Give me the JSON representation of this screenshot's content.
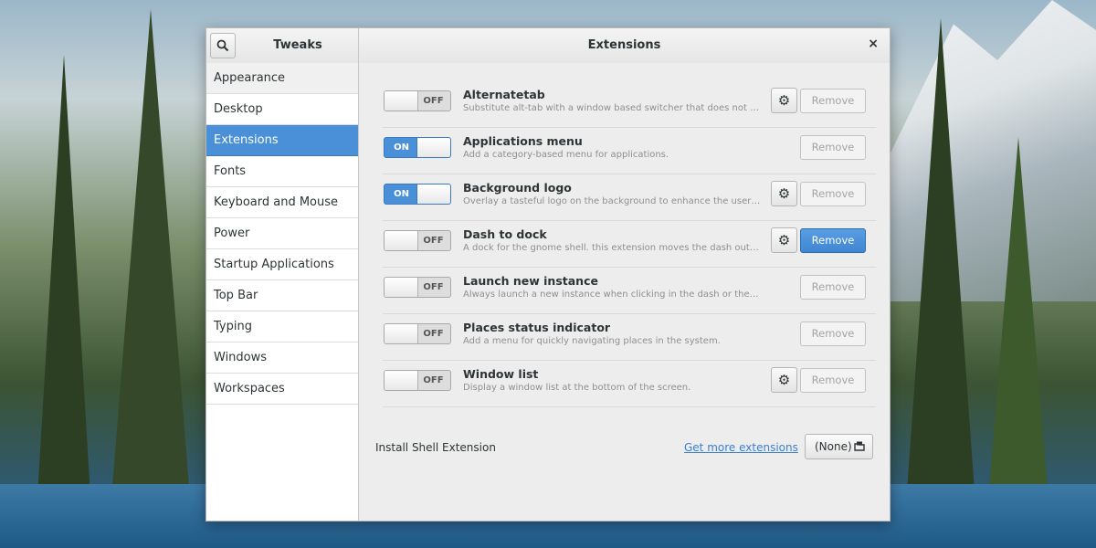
{
  "window": {
    "app_title": "Tweaks",
    "page_title": "Extensions",
    "close_glyph": "×"
  },
  "sidebar": {
    "items": [
      {
        "label": "Appearance",
        "state": "hover"
      },
      {
        "label": "Desktop",
        "state": ""
      },
      {
        "label": "Extensions",
        "state": "selected"
      },
      {
        "label": "Fonts",
        "state": ""
      },
      {
        "label": "Keyboard and Mouse",
        "state": ""
      },
      {
        "label": "Power",
        "state": ""
      },
      {
        "label": "Startup Applications",
        "state": ""
      },
      {
        "label": "Top Bar",
        "state": ""
      },
      {
        "label": "Typing",
        "state": ""
      },
      {
        "label": "Windows",
        "state": ""
      },
      {
        "label": "Workspaces",
        "state": ""
      }
    ]
  },
  "extensions": [
    {
      "name": "Alternatetab",
      "description": "Substitute alt-tab with a window based switcher that does not group...",
      "toggle": "OFF",
      "has_settings": true,
      "remove_label": "Remove",
      "remove_active": false
    },
    {
      "name": "Applications menu",
      "description": "Add a category-based menu for applications.",
      "toggle": "ON",
      "has_settings": false,
      "remove_label": "Remove",
      "remove_active": false
    },
    {
      "name": "Background logo",
      "description": "Overlay a tasteful logo on the background to enhance the user experie...",
      "toggle": "ON",
      "has_settings": true,
      "remove_label": "Remove",
      "remove_active": false
    },
    {
      "name": "Dash to dock",
      "description": "A dock for the gnome shell. this extension moves the dash out of the ...",
      "toggle": "OFF",
      "has_settings": true,
      "remove_label": "Remove",
      "remove_active": true
    },
    {
      "name": "Launch new instance",
      "description": "Always launch a new instance when clicking in the dash or the application vie...",
      "toggle": "OFF",
      "has_settings": false,
      "remove_label": "Remove",
      "remove_active": false
    },
    {
      "name": "Places status indicator",
      "description": "Add a menu for quickly navigating places in the system.",
      "toggle": "OFF",
      "has_settings": false,
      "remove_label": "Remove",
      "remove_active": false
    },
    {
      "name": "Window list",
      "description": "Display a window list at the bottom of the screen.",
      "toggle": "OFF",
      "has_settings": true,
      "remove_label": "Remove",
      "remove_active": false
    }
  ],
  "install": {
    "label": "Install Shell Extension",
    "link": "Get more extensions",
    "file_button": "(None)"
  },
  "colors": {
    "accent": "#4a90d9",
    "toggle_off": "#dddddd",
    "muted_text": "#8f8f8f"
  },
  "icons": {
    "search": "search-icon",
    "close": "close-icon",
    "settings": "gear-icon",
    "file": "file-open-icon"
  }
}
